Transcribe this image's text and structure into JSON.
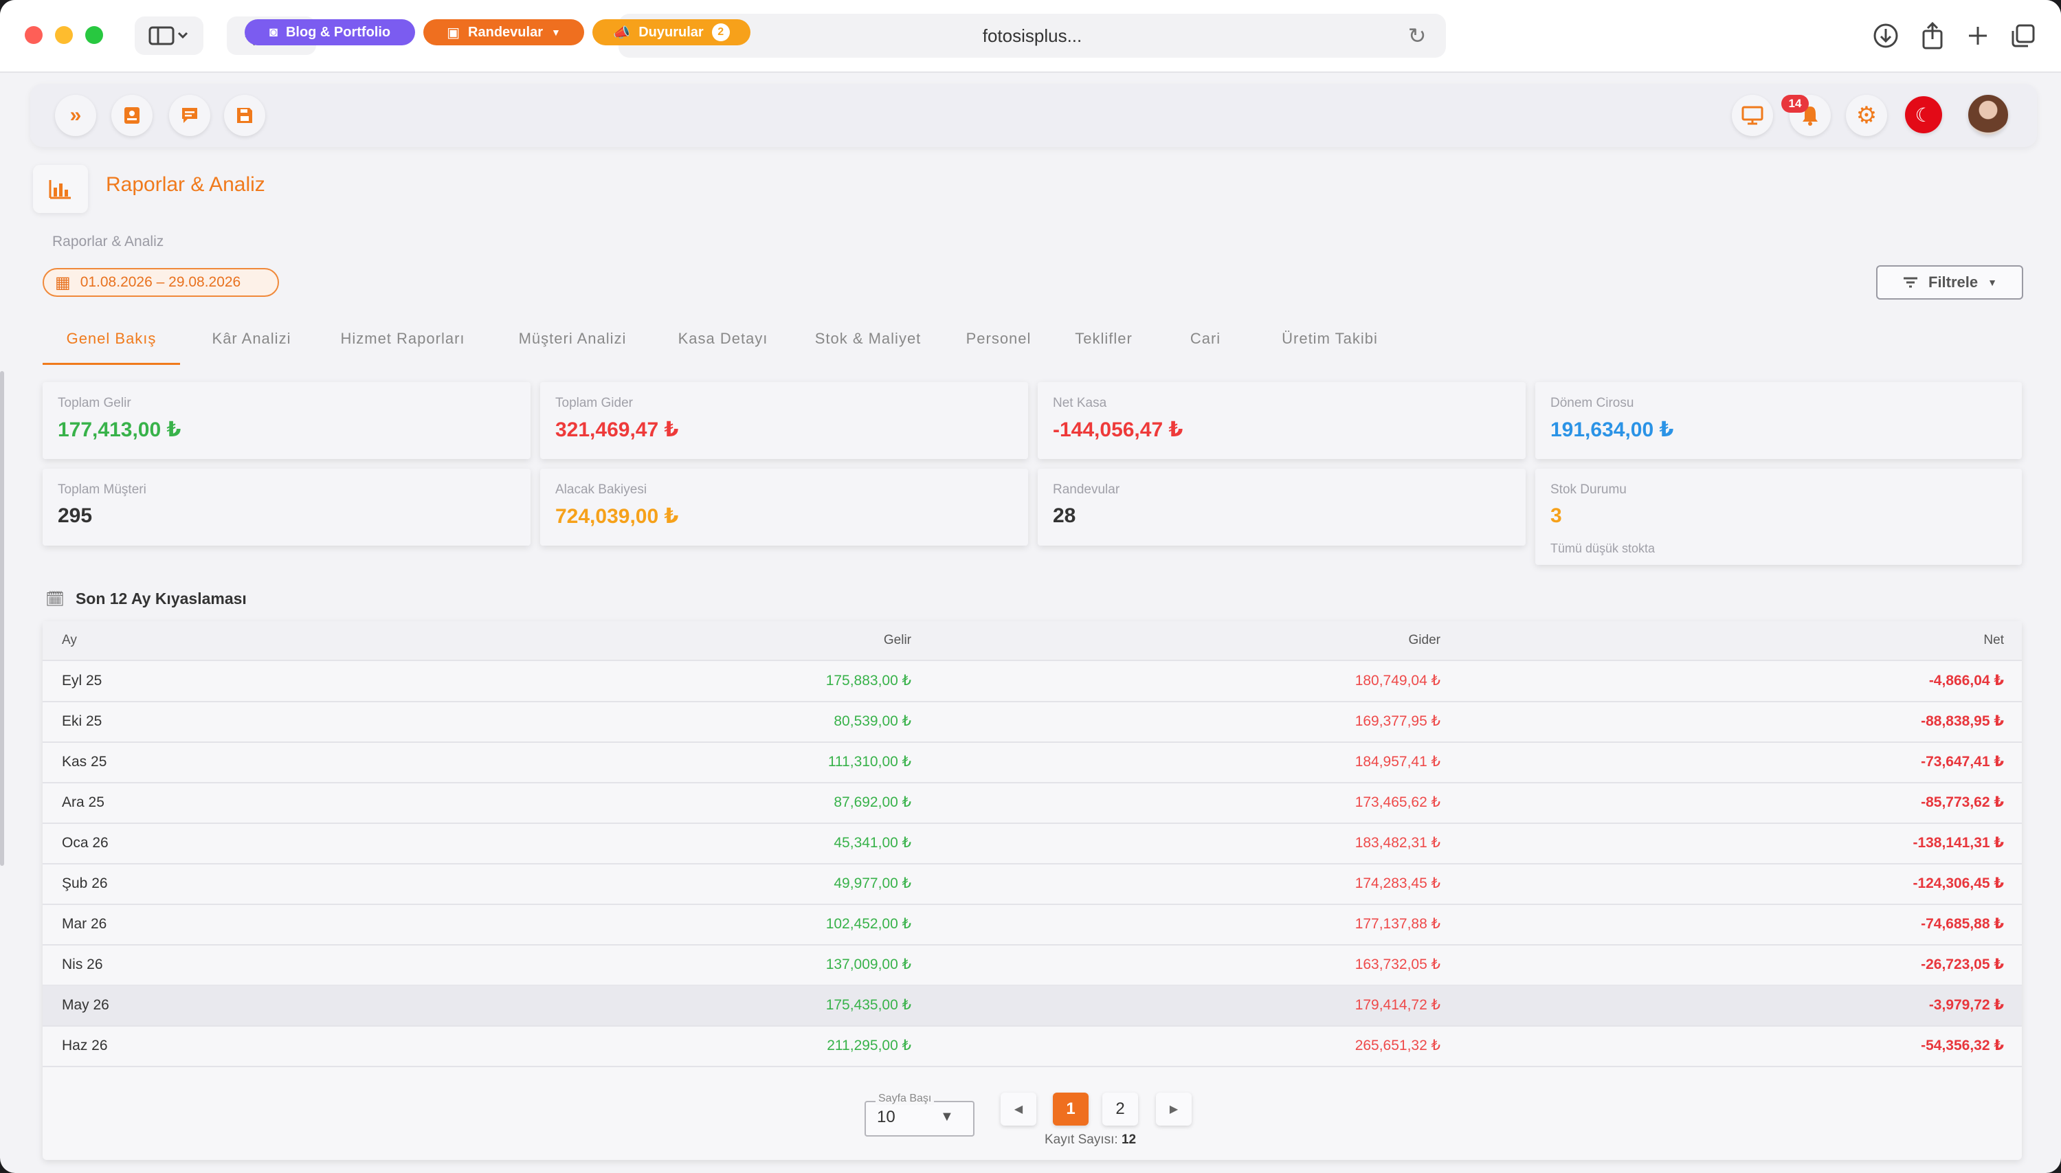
{
  "browser": {
    "url": "fotosisplus..."
  },
  "topbar": {
    "blog_label": "Blog & Portfolio",
    "randevular_label": "Randevular",
    "duyurular_label": "Duyurular",
    "duyurular_count": "2",
    "notifications_count": "14",
    "flag_glyph": "☾"
  },
  "page": {
    "title": "Raporlar & Analiz",
    "breadcrumb": "Raporlar & Analiz",
    "date_range": "01.08.2026 – 29.08.2026",
    "filter_label": "Filtrele"
  },
  "tabs": [
    {
      "label": "Genel Bakış",
      "active": true
    },
    {
      "label": "Kâr Analizi"
    },
    {
      "label": "Hizmet Raporları"
    },
    {
      "label": "Müşteri Analizi"
    },
    {
      "label": "Kasa Detayı"
    },
    {
      "label": "Stok & Maliyet"
    },
    {
      "label": "Personel"
    },
    {
      "label": "Teklifler"
    },
    {
      "label": "Cari"
    },
    {
      "label": "Üretim Takibi"
    }
  ],
  "cards": [
    {
      "label": "Toplam Gelir",
      "value": "177,413,00 ₺",
      "tone": "green"
    },
    {
      "label": "Toplam Gider",
      "value": "321,469,47 ₺",
      "tone": "red"
    },
    {
      "label": "Net Kasa",
      "value": "-144,056,47 ₺",
      "tone": "red"
    },
    {
      "label": "Dönem Cirosu",
      "value": "191,634,00 ₺",
      "tone": "blue"
    },
    {
      "label": "Toplam Müşteri",
      "value": "295",
      "tone": "dark"
    },
    {
      "label": "Alacak Bakiyesi",
      "value": "724,039,00 ₺",
      "tone": "orange"
    },
    {
      "label": "Randevular",
      "value": "28",
      "tone": "dark"
    },
    {
      "label": "Stok Durumu",
      "value": "3",
      "tone": "orange",
      "sub": "Tümü düşük stokta"
    }
  ],
  "comparison": {
    "title": "Son 12 Ay Kıyaslaması",
    "columns": {
      "month": "Ay",
      "income": "Gelir",
      "expense": "Gider",
      "net": "Net"
    },
    "rows": [
      {
        "month": "Eyl 25",
        "income": "175,883,00 ₺",
        "expense": "180,749,04 ₺",
        "net": "-4,866,04 ₺"
      },
      {
        "month": "Eki 25",
        "income": "80,539,00 ₺",
        "expense": "169,377,95 ₺",
        "net": "-88,838,95 ₺"
      },
      {
        "month": "Kas 25",
        "income": "111,310,00 ₺",
        "expense": "184,957,41 ₺",
        "net": "-73,647,41 ₺"
      },
      {
        "month": "Ara 25",
        "income": "87,692,00 ₺",
        "expense": "173,465,62 ₺",
        "net": "-85,773,62 ₺"
      },
      {
        "month": "Oca 26",
        "income": "45,341,00 ₺",
        "expense": "183,482,31 ₺",
        "net": "-138,141,31 ₺"
      },
      {
        "month": "Şub 26",
        "income": "49,977,00 ₺",
        "expense": "174,283,45 ₺",
        "net": "-124,306,45 ₺"
      },
      {
        "month": "Mar 26",
        "income": "102,452,00 ₺",
        "expense": "177,137,88 ₺",
        "net": "-74,685,88 ₺"
      },
      {
        "month": "Nis 26",
        "income": "137,009,00 ₺",
        "expense": "163,732,05 ₺",
        "net": "-26,723,05 ₺"
      },
      {
        "month": "May 26",
        "income": "175,435,00 ₺",
        "expense": "179,414,72 ₺",
        "net": "-3,979,72 ₺"
      },
      {
        "month": "Haz 26",
        "income": "211,295,00 ₺",
        "expense": "265,651,32 ₺",
        "net": "-54,356,32 ₺"
      }
    ],
    "highlighted_row": 8
  },
  "pagination": {
    "per_page_label": "Sayfa Başı",
    "per_page_value": "10",
    "pages": [
      "1",
      "2"
    ],
    "active_page": "1",
    "record_label": "Kayıt Sayısı:",
    "record_count": "12"
  },
  "colors": {
    "accent": "#f07a1c",
    "income": "#38b24a",
    "expense": "#ee3a3a",
    "info": "#2b93e6",
    "warning": "#f6a11a",
    "blog_pill": "#7b5cf0"
  },
  "icons": {
    "expand": "double-chevron-right-icon",
    "contacts": "contacts-icon",
    "chat": "chat-icon",
    "save": "save-icon",
    "camera": "camera-icon",
    "calendar": "calendar-icon",
    "megaphone": "megaphone-icon",
    "monitor": "monitor-icon",
    "bell": "bell-icon",
    "gear": "gear-icon",
    "chart": "bar-chart-icon"
  }
}
